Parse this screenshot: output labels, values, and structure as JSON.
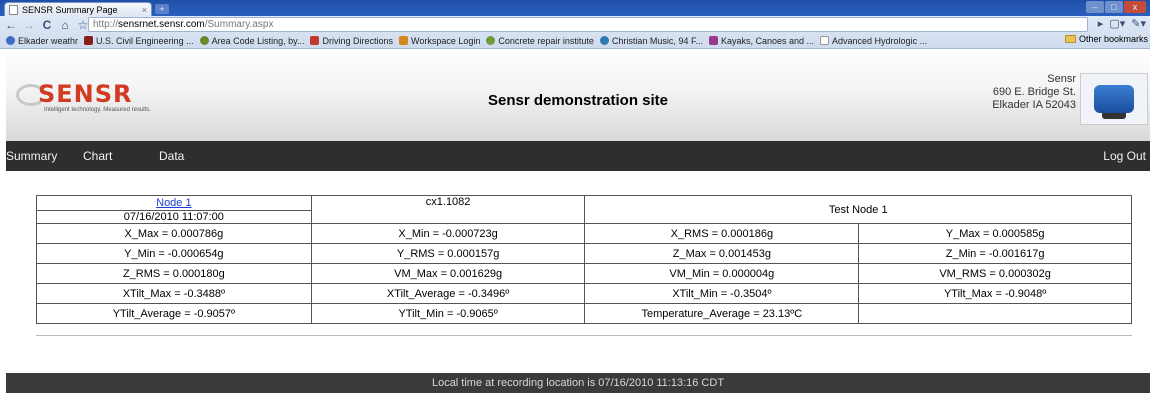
{
  "browser": {
    "tab_title": "SENSR Summary Page",
    "tab_close": "×",
    "url_scheme": "http://",
    "url_host": "sensrnet.sensr.com",
    "url_path": "/Summary.aspx",
    "bookmarks": [
      {
        "label": "Elkader weathr",
        "icon": "weather-icon",
        "color": "#3b6fc4"
      },
      {
        "label": "U.S. Civil Engineering ...",
        "icon": "flag-icon",
        "color": "#8b1c1c"
      },
      {
        "label": "Area Code Listing, by...",
        "icon": "pin-icon",
        "color": "#6a8a2a"
      },
      {
        "label": "Driving Directions",
        "icon": "map-pin-icon",
        "color": "#c0392b"
      },
      {
        "label": "Workspace Login",
        "icon": "workspace-icon",
        "color": "#d08a1e"
      },
      {
        "label": "Concrete repair institute",
        "icon": "globe-icon",
        "color": "#6f9a3a"
      },
      {
        "label": "Christian Music, 94 F...",
        "icon": "radio-icon",
        "color": "#2d7bb5"
      },
      {
        "label": "Kayaks, Canoes and ...",
        "icon": "paddle-icon",
        "color": "#9a3a8a"
      },
      {
        "label": "Advanced Hydrologic ...",
        "icon": "page-icon",
        "color": "#cccccc"
      }
    ],
    "other_bookmarks": "Other bookmarks"
  },
  "header": {
    "logo_text": "SENSR",
    "logo_tagline": "Intelligent technology. Measured results.",
    "site_title": "Sensr demonstration site",
    "address": [
      "Sensr",
      "690 E. Bridge St.",
      "Elkader IA 52043"
    ]
  },
  "menu": {
    "summary": "Summary",
    "chart": "Chart",
    "data": "Data",
    "logout": "Log Out"
  },
  "node": {
    "name": "Node 1",
    "timestamp": "07/16/2010 11:07:00",
    "serial": "cx1.1082",
    "description": "Test Node 1"
  },
  "readings": [
    [
      "X_Max = 0.000786g",
      "X_Min = -0.000723g",
      "X_RMS = 0.000186g",
      "Y_Max = 0.000585g"
    ],
    [
      "Y_Min = -0.000654g",
      "Y_RMS = 0.000157g",
      "Z_Max = 0.001453g",
      "Z_Min = -0.001617g"
    ],
    [
      "Z_RMS = 0.000180g",
      "VM_Max = 0.001629g",
      "VM_Min = 0.000004g",
      "VM_RMS = 0.000302g"
    ],
    [
      "XTilt_Max = -0.3488º",
      "XTilt_Average = -0.3496º",
      "XTilt_Min = -0.3504º",
      "YTilt_Max = -0.9048º"
    ],
    [
      "YTilt_Average = -0.9057º",
      "YTilt_Min = -0.9065º",
      "Temperature_Average = 23.13ºC",
      ""
    ]
  ],
  "footer": "Local time at recording location is 07/16/2010 11:13:16 CDT"
}
